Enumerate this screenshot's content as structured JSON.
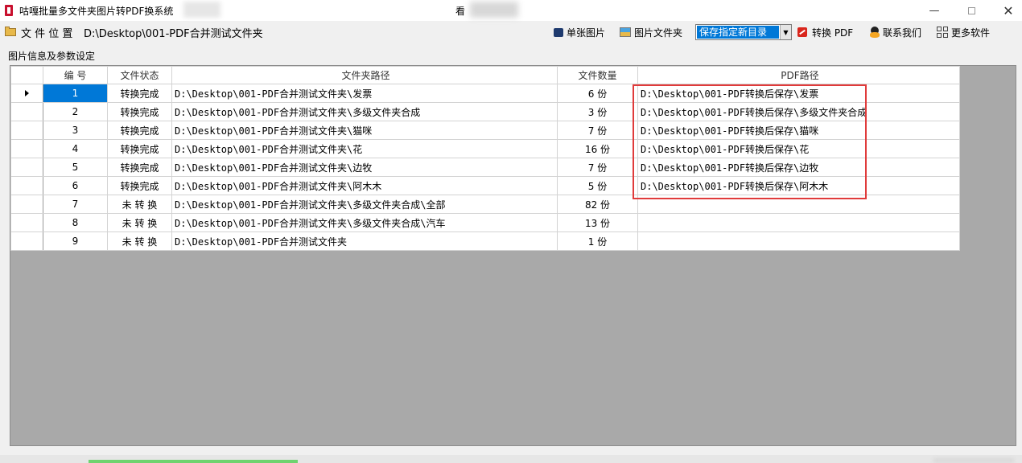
{
  "window": {
    "title": "咕嘎批量多文件夹图片转PDF换系统",
    "center_title": "看",
    "controls": {
      "minimize": "—",
      "close": "✕"
    }
  },
  "toolbar": {
    "file_location_label": "文 件 位 置",
    "path_value": "D:\\Desktop\\001-PDF合并测试文件夹",
    "single_image": "单张图片",
    "image_folder": "图片文件夹",
    "save_option": "保存指定新目录",
    "convert_pdf": "转换 PDF",
    "contact_us": "联系我们",
    "more_software": "更多软件"
  },
  "group_label": "图片信息及参数设定",
  "table": {
    "headers": [
      "编 号",
      "文件状态",
      "文件夹路径",
      "文件数量",
      "PDF路径"
    ],
    "rows": [
      {
        "no": "1",
        "status": "转换完成",
        "path": "D:\\Desktop\\001-PDF合并测试文件夹\\发票",
        "count": "6 份",
        "pdf": "D:\\Desktop\\001-PDF转换后保存\\发票"
      },
      {
        "no": "2",
        "status": "转换完成",
        "path": "D:\\Desktop\\001-PDF合并测试文件夹\\多级文件夹合成",
        "count": "3 份",
        "pdf": "D:\\Desktop\\001-PDF转换后保存\\多级文件夹合成"
      },
      {
        "no": "3",
        "status": "转换完成",
        "path": "D:\\Desktop\\001-PDF合并测试文件夹\\猫咪",
        "count": "7 份",
        "pdf": "D:\\Desktop\\001-PDF转换后保存\\猫咪"
      },
      {
        "no": "4",
        "status": "转换完成",
        "path": "D:\\Desktop\\001-PDF合并测试文件夹\\花",
        "count": "16 份",
        "pdf": "D:\\Desktop\\001-PDF转换后保存\\花"
      },
      {
        "no": "5",
        "status": "转换完成",
        "path": "D:\\Desktop\\001-PDF合并测试文件夹\\边牧",
        "count": "7 份",
        "pdf": "D:\\Desktop\\001-PDF转换后保存\\边牧"
      },
      {
        "no": "6",
        "status": "转换完成",
        "path": "D:\\Desktop\\001-PDF合并测试文件夹\\阿木木",
        "count": "5 份",
        "pdf": "D:\\Desktop\\001-PDF转换后保存\\阿木木"
      },
      {
        "no": "7",
        "status": "未 转 换",
        "path": "D:\\Desktop\\001-PDF合并测试文件夹\\多级文件夹合成\\全部",
        "count": "82 份",
        "pdf": ""
      },
      {
        "no": "8",
        "status": "未 转 换",
        "path": "D:\\Desktop\\001-PDF合并测试文件夹\\多级文件夹合成\\汽车",
        "count": "13 份",
        "pdf": ""
      },
      {
        "no": "9",
        "status": "未 转 换",
        "path": "D:\\Desktop\\001-PDF合并测试文件夹",
        "count": "1 份",
        "pdf": ""
      }
    ]
  },
  "colors": {
    "selection": "#0078d7",
    "highlight_box": "#e03b3b",
    "grid_background": "#a9a9a9"
  }
}
